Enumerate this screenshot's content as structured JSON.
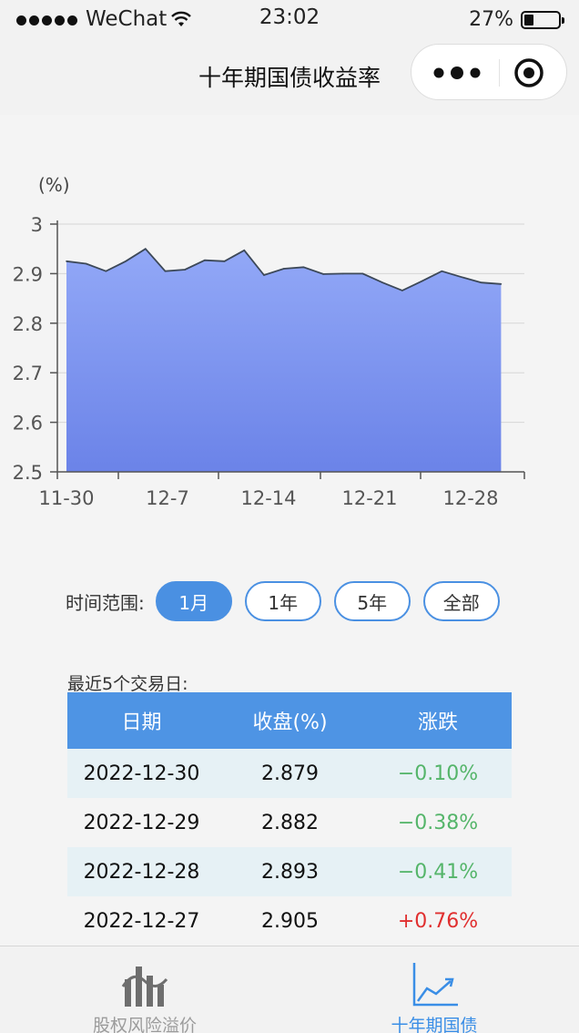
{
  "status_bar": {
    "carrier": "WeChat",
    "time": "23:02",
    "battery": "27%",
    "battery_level": 0.27
  },
  "nav": {
    "title": "十年期国债收益率",
    "more_icon": "more-dots-icon",
    "close_icon": "target-close-icon"
  },
  "chart_data": {
    "type": "area",
    "ylabel": "(%)",
    "ylim": [
      2.5,
      3.0
    ],
    "yticks": [
      "3",
      "2.9",
      "2.8",
      "2.7",
      "2.6",
      "2.5"
    ],
    "xticks": [
      "11-30",
      "12-7",
      "12-14",
      "12-21",
      "12-28"
    ],
    "grid": true,
    "colors": {
      "line": "#3c4858",
      "fill_top": "#92a8f7",
      "fill_bottom": "#6b83e8"
    },
    "x": [
      "11-30",
      "12-1",
      "12-2",
      "12-5",
      "12-6",
      "12-7",
      "12-8",
      "12-9",
      "12-12",
      "12-13",
      "12-14",
      "12-15",
      "12-16",
      "12-19",
      "12-20",
      "12-21",
      "12-22",
      "12-23",
      "12-26",
      "12-27",
      "12-28",
      "12-29",
      "12-30"
    ],
    "values": [
      2.925,
      2.92,
      2.905,
      2.925,
      2.95,
      2.905,
      2.908,
      2.927,
      2.925,
      2.947,
      2.897,
      2.91,
      2.913,
      2.899,
      2.9,
      2.9,
      2.882,
      2.866,
      2.885,
      2.905,
      2.893,
      2.882,
      2.879
    ]
  },
  "range": {
    "label": "时间范围:",
    "buttons": [
      "1月",
      "1年",
      "5年",
      "全部"
    ],
    "active_index": 0
  },
  "recent": {
    "title": "最近5个交易日:",
    "headers": [
      "日期",
      "收盘(%)",
      "涨跌"
    ],
    "rows": [
      {
        "date": "2022-12-30",
        "close": "2.879",
        "change": "−0.10%",
        "direction": "down"
      },
      {
        "date": "2022-12-29",
        "close": "2.882",
        "change": "−0.38%",
        "direction": "down"
      },
      {
        "date": "2022-12-28",
        "close": "2.893",
        "change": "−0.41%",
        "direction": "down"
      },
      {
        "date": "2022-12-27",
        "close": "2.905",
        "change": "+0.76%",
        "direction": "up"
      }
    ]
  },
  "tabbar": {
    "tabs": [
      {
        "label": "股权风险溢价",
        "icon": "bar-chart-icon",
        "active": false
      },
      {
        "label": "十年期国债",
        "icon": "line-trend-icon",
        "active": true
      }
    ],
    "active_color": "#3a8ee6"
  }
}
